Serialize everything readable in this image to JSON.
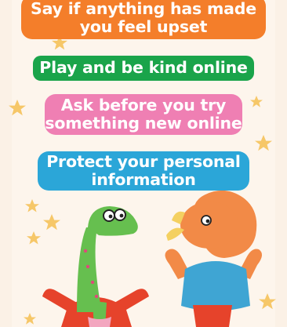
{
  "rules": [
    {
      "lines": [
        "Say if anything has made",
        "you feel upset"
      ],
      "color": "#f47e2a"
    },
    {
      "lines": [
        "Play and be kind online"
      ],
      "color": "#1aa44a"
    },
    {
      "lines": [
        "Ask before you try",
        "something new online"
      ],
      "color": "#ef7fb3"
    },
    {
      "lines": [
        "Protect your personal",
        "information"
      ],
      "color": "#2ba6d8"
    }
  ],
  "decorations": {
    "star_color": "#f6c768",
    "characters": [
      "dinosaur-character",
      "triceratops-character"
    ]
  }
}
